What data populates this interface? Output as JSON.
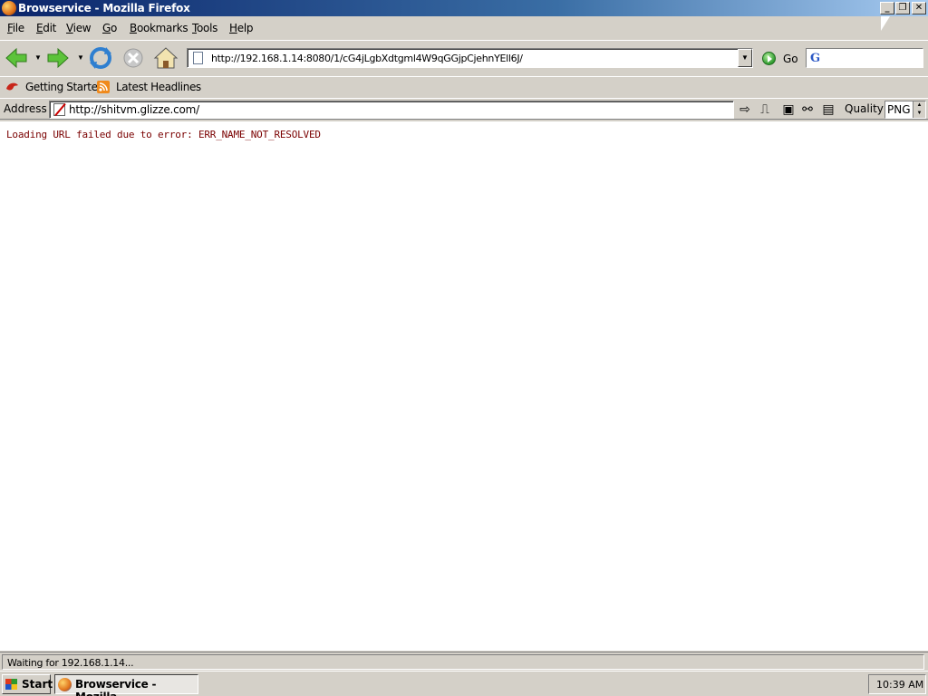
{
  "window": {
    "title": "Browservice - Mozilla Firefox",
    "min": "_",
    "restore": "❐",
    "close": "✕"
  },
  "menu": {
    "items": [
      "File",
      "Edit",
      "View",
      "Go",
      "Bookmarks",
      "Tools",
      "Help"
    ]
  },
  "nav": {
    "url": "http://192.168.1.14:8080/1/cG4jLgbXdtgml4W9qGGjpCjehnYEll6J/",
    "go_label": "Go",
    "search_icon": "G"
  },
  "bookmarks": {
    "items": [
      "Getting Started",
      "Latest Headlines"
    ]
  },
  "addressbar": {
    "label": "Address",
    "url": "http://shitvm.glizze.com/",
    "quality_label": "Quality",
    "quality_value": "PNG"
  },
  "content": {
    "error": "Loading URL failed due to error: ERR_NAME_NOT_RESOLVED"
  },
  "status": {
    "text": "Waiting for 192.168.1.14..."
  },
  "taskbar": {
    "start": "Start",
    "task": "Browservice - Mozilla...",
    "clock": "10:39 AM"
  }
}
